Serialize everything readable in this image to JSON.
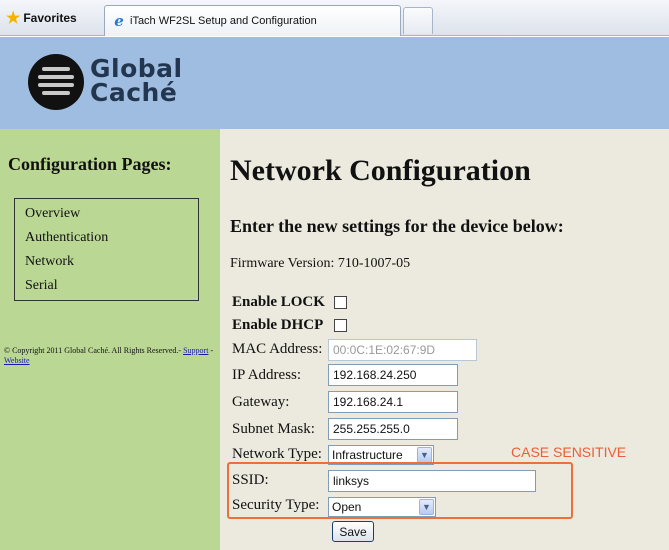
{
  "browser": {
    "favorites_label": "Favorites",
    "tab_title": "iTach WF2SL Setup and Configuration"
  },
  "logo": {
    "line1": "Global",
    "line2": "Caché"
  },
  "sidebar": {
    "title": "Configuration Pages:",
    "items": [
      {
        "label": "Overview"
      },
      {
        "label": "Authentication"
      },
      {
        "label": "Network"
      },
      {
        "label": "Serial"
      }
    ],
    "copyright": "© Copyright 2011 Global Caché. All Rights Reserved.-",
    "support_link": "Support",
    "separator": "-",
    "website_link": "Website"
  },
  "main": {
    "title": "Network Configuration",
    "subtitle": "Enter the new settings for the device below:",
    "firmware": "Firmware Version: 710-1007-05",
    "enable_lock_label": "Enable LOCK",
    "enable_lock_checked": false,
    "enable_dhcp_label": "Enable DHCP",
    "enable_dhcp_checked": false,
    "mac_label": "MAC Address:",
    "mac_value": "00:0C:1E:02:67:9D",
    "ip_label": "IP Address:",
    "ip_value": "192.168.24.250",
    "gateway_label": "Gateway:",
    "gateway_value": "192.168.24.1",
    "subnet_label": "Subnet Mask:",
    "subnet_value": "255.255.255.0",
    "network_type_label": "Network Type:",
    "network_type_value": "Infrastructure",
    "case_note": "CASE SENSITIVE",
    "ssid_label": "SSID:",
    "ssid_value": "linksys",
    "security_label": "Security Type:",
    "security_value": "Open",
    "save_label": "Save"
  },
  "colors": {
    "header_bg": "#9fbde0",
    "sidebar_bg": "#bad794",
    "main_bg": "#eceade",
    "highlight": "#ee6e3e",
    "logo_text": "#23364f"
  },
  "icons": [
    "favorites-star-icon",
    "ie-page-icon",
    "globe-logo-icon",
    "dropdown-arrow-icon"
  ]
}
